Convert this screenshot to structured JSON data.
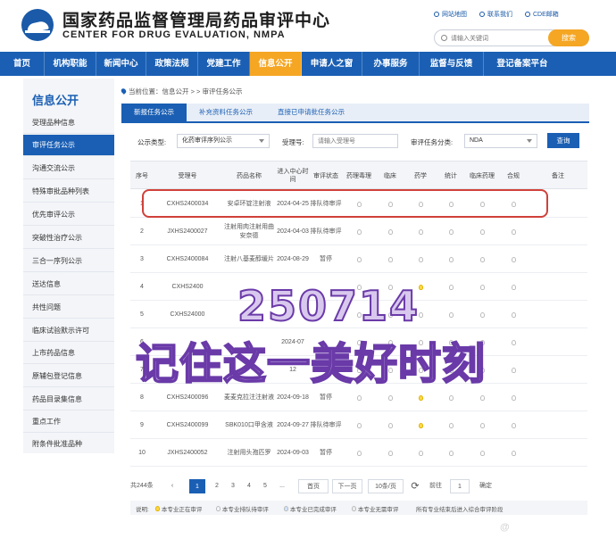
{
  "header": {
    "title_cn": "国家药品监督管理局药品审评中心",
    "title_en": "CENTER FOR DRUG EVALUATION, NMPA",
    "links": [
      {
        "label": "网站地图",
        "icon": "map-icon"
      },
      {
        "label": "联系我们",
        "icon": "contact-icon"
      },
      {
        "label": "CDE邮箱",
        "icon": "mail-icon"
      }
    ],
    "search_placeholder": "请输入关键词",
    "search_button": "搜索"
  },
  "nav": [
    {
      "label": "首页",
      "active": false
    },
    {
      "label": "机构职能",
      "active": false
    },
    {
      "label": "新闻中心",
      "active": false
    },
    {
      "label": "政策法规",
      "active": false
    },
    {
      "label": "党建工作",
      "active": false
    },
    {
      "label": "信息公开",
      "active": true
    },
    {
      "label": "申请人之窗",
      "active": false
    },
    {
      "label": "办事服务",
      "active": false
    },
    {
      "label": "监督与反馈",
      "active": false
    },
    {
      "label": "登记备案平台",
      "active": false
    }
  ],
  "sidebar": {
    "title": "信息公开",
    "items": [
      {
        "label": "受理品种信息",
        "active": false
      },
      {
        "label": "审评任务公示",
        "active": true
      },
      {
        "label": "沟通交流公示",
        "active": false
      },
      {
        "label": "特殊审批品种列表",
        "active": false
      },
      {
        "label": "优先审评公示",
        "active": false
      },
      {
        "label": "突破性治疗公示",
        "active": false
      },
      {
        "label": "三合一序列公示",
        "active": false
      },
      {
        "label": "送达信息",
        "active": false
      },
      {
        "label": "共性问题",
        "active": false
      },
      {
        "label": "临床试验默示许可",
        "active": false
      },
      {
        "label": "上市药品信息",
        "active": false
      },
      {
        "label": "原辅包登记信息",
        "active": false
      },
      {
        "label": "药品目录集信息",
        "active": false
      },
      {
        "label": "重点工作",
        "active": false
      },
      {
        "label": "附条件批准品种",
        "active": false
      }
    ]
  },
  "breadcrumb": "当前位置：信息公开 > > 审评任务公示",
  "tabs": [
    {
      "label": "新报任务公示",
      "active": true
    },
    {
      "label": "补充资料任务公示",
      "active": false
    },
    {
      "label": "直接已申请批任务公示",
      "active": false
    }
  ],
  "filters": {
    "type_label": "公示类型:",
    "type_value": "化药审评序列公示",
    "accept_label": "受理号:",
    "accept_placeholder": "请输入受理号",
    "category_label": "审评任务分类:",
    "category_value": "NDA",
    "query_button": "查询"
  },
  "table": {
    "headers": [
      "序号",
      "受理号",
      "药品名称",
      "进入中心时间",
      "审评状态",
      "药理毒理",
      "临床",
      "药学",
      "统计",
      "临床药理",
      "合规",
      "备注"
    ],
    "rows": [
      {
        "no": "1",
        "accept": "CXHS2400034",
        "name": "安卓环锭注射液",
        "date": "2024-04-25",
        "status": "排队待审评",
        "lights": [
          false,
          false,
          false,
          false,
          false,
          false
        ]
      },
      {
        "no": "2",
        "accept": "JXHS2400027",
        "name": "注射用肉注射用曲安奈德",
        "date": "2024-04-03",
        "status": "排队待审评",
        "lights": [
          false,
          false,
          false,
          false,
          false,
          false
        ]
      },
      {
        "no": "3",
        "accept": "CXHS2400084",
        "name": "注射八基麦醇缓片",
        "date": "2024-08-29",
        "status": "暂停",
        "lights": [
          false,
          false,
          false,
          false,
          false,
          false
        ]
      },
      {
        "no": "4",
        "accept": "CXHS2400",
        "name": "",
        "date": "",
        "status": "",
        "lights": [
          false,
          false,
          true,
          false,
          false,
          false
        ]
      },
      {
        "no": "5",
        "accept": "CXHS24000",
        "name": "",
        "date": "",
        "status": "",
        "lights": [
          false,
          false,
          false,
          false,
          false,
          false
        ]
      },
      {
        "no": "6",
        "accept": "",
        "name": "",
        "date": "2024-07",
        "status": "",
        "lights": [
          false,
          false,
          false,
          false,
          false,
          false
        ]
      },
      {
        "no": "7",
        "accept": "",
        "name": "",
        "date": "12",
        "status": "",
        "lights": [
          false,
          false,
          false,
          false,
          false,
          false
        ]
      },
      {
        "no": "8",
        "accept": "CXHS2400096",
        "name": "麦麦克拉注注射液",
        "date": "2024-09-18",
        "status": "暂停",
        "lights": [
          false,
          false,
          true,
          false,
          false,
          false
        ]
      },
      {
        "no": "9",
        "accept": "CXHS2400099",
        "name": "SBK010口甲含液",
        "date": "2024-09-27",
        "status": "排队待审评",
        "lights": [
          false,
          false,
          true,
          false,
          false,
          false
        ]
      },
      {
        "no": "10",
        "accept": "JXHS2400052",
        "name": "注射用头孢匹罗",
        "date": "2024-09-03",
        "status": "暂停",
        "lights": [
          false,
          false,
          false,
          false,
          false,
          false
        ]
      }
    ]
  },
  "overlay": {
    "number": "250714",
    "caption": "记住这一美好时刻"
  },
  "pager": {
    "total": "共244条",
    "prev": "‹",
    "pages": [
      "1",
      "2",
      "3",
      "4",
      "5"
    ],
    "ellipsis": "...",
    "first": "首页",
    "next_label": "下一页",
    "page_size": "10条/页",
    "goto": "前往",
    "goto_value": "1",
    "confirm": "确定",
    "refresh_icon": "refresh-icon"
  },
  "legend": {
    "title": "说明:",
    "items": [
      "本专业正在审评",
      "本专业排队待审评",
      "本专业已完成审评",
      "本专业无需审评",
      "所有专业结束后进入综合审评阶段"
    ],
    "on_color": "#ffd84a"
  },
  "watermark": "@"
}
